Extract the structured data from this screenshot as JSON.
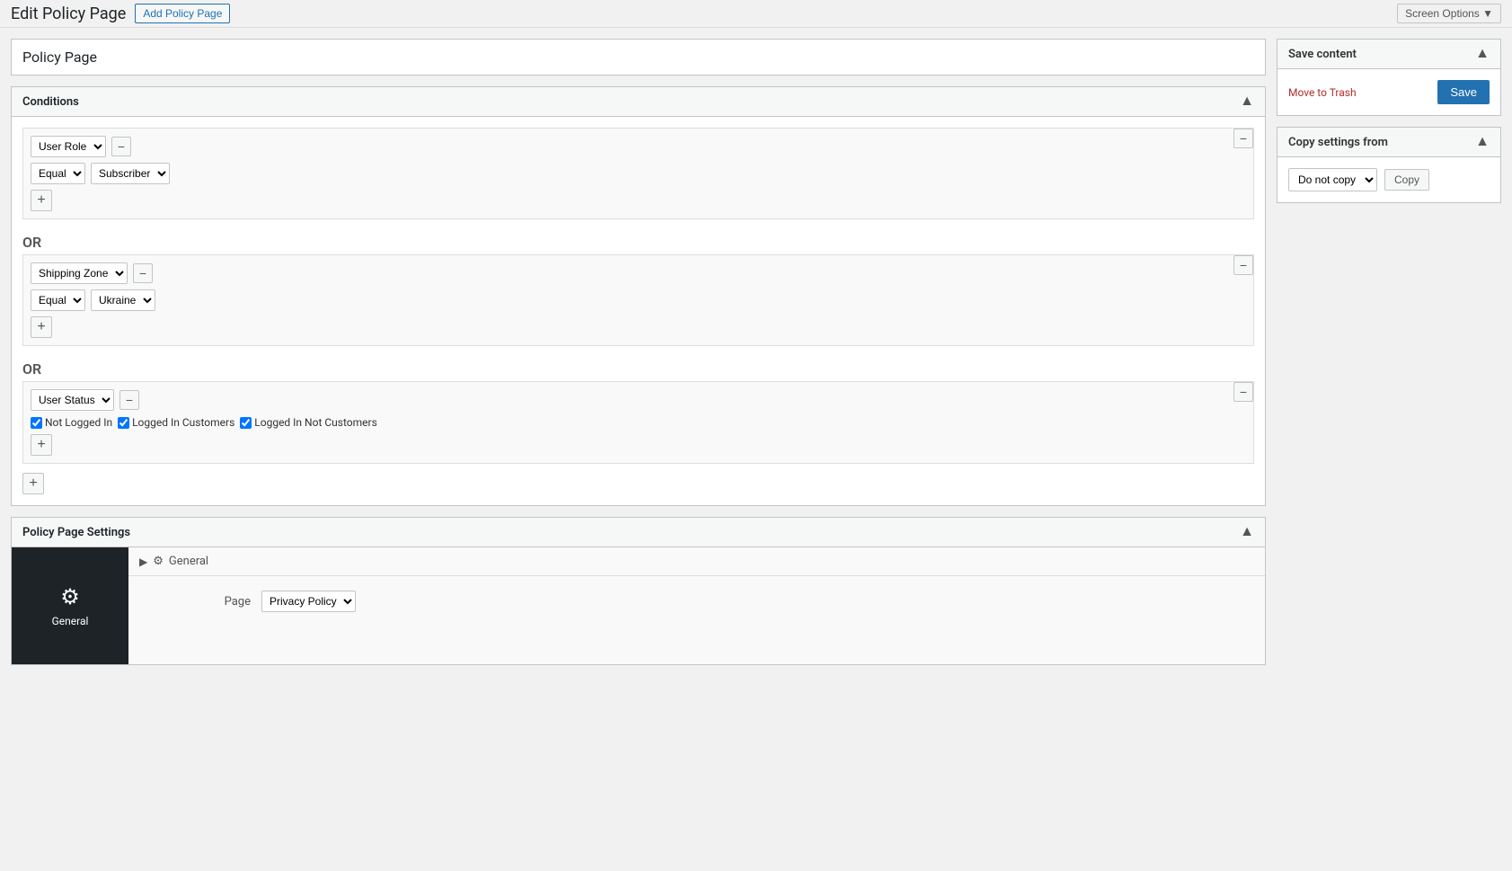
{
  "topBar": {
    "screenOptions": "Screen Options ▼"
  },
  "header": {
    "title": "Edit Policy Page",
    "addPolicyBtn": "Add Policy Page"
  },
  "policyPageTitle": "Policy Page",
  "conditions": {
    "panelTitle": "Conditions",
    "groups": [
      {
        "id": "group1",
        "rows": [
          {
            "type": "User Role",
            "operator": "Equal",
            "value": "Subscriber"
          }
        ]
      },
      {
        "id": "group2",
        "rows": [
          {
            "type": "Shipping Zone",
            "operator": "Equal",
            "value": "Ukraine"
          }
        ]
      },
      {
        "id": "group3",
        "rows": [
          {
            "type": "User Status",
            "checkboxes": [
              {
                "label": "Not Logged In",
                "checked": true
              },
              {
                "label": "Logged In Customers",
                "checked": true
              },
              {
                "label": "Logged In Not Customers",
                "checked": true
              }
            ]
          }
        ]
      }
    ],
    "orLabel": "OR",
    "addBtn": "+",
    "removeBtn": "−"
  },
  "policySettings": {
    "panelTitle": "Policy Page Settings",
    "tab": {
      "iconLabel": "⚙",
      "label": "General"
    },
    "contentHeader": "⚙ General",
    "pageField": {
      "label": "Page",
      "value": "Privacy Policy"
    }
  },
  "savecontent": {
    "title": "Save content",
    "moveToTrash": "Move to Trash",
    "saveBtn": "Save"
  },
  "copySettings": {
    "title": "Copy settings from",
    "selectValue": "Do not copy",
    "copyBtn": "Copy"
  }
}
